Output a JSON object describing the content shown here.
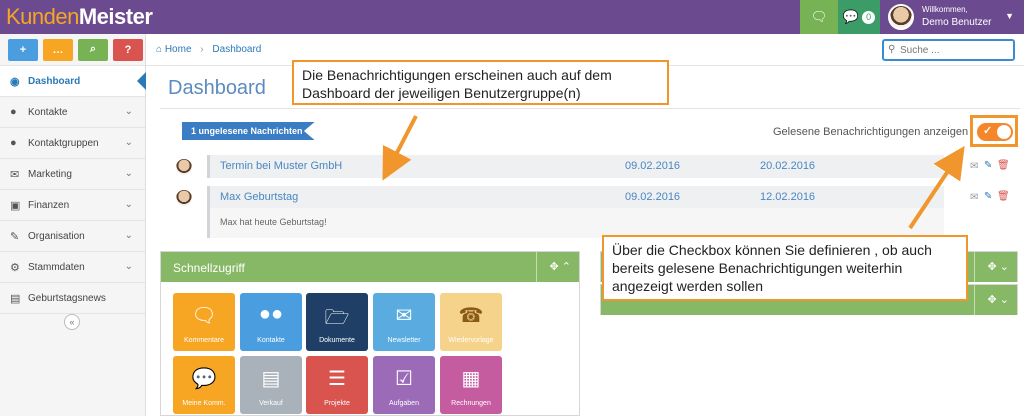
{
  "app": {
    "logo_part1": "Kunden",
    "logo_part2": "Meister"
  },
  "topbar": {
    "chat_icon": "comments-icon",
    "notif_icon": "comment-icon",
    "notif_count": "0",
    "user_welcome": "Willkommen,",
    "user_name": "Demo Benutzer"
  },
  "quick_actions": [
    {
      "label": "+",
      "icon": "plus-icon",
      "color": "#4a9ee0"
    },
    {
      "label": "…",
      "icon": "comments-icon",
      "color": "#f6a623"
    },
    {
      "label": "⌕",
      "icon": "search-icon",
      "color": "#77b255"
    },
    {
      "label": "?",
      "icon": "help-icon",
      "color": "#d9534f"
    }
  ],
  "sidebar": {
    "items": [
      {
        "label": "Dashboard",
        "icon": "dashboard-icon",
        "active": true
      },
      {
        "label": "Kontakte",
        "icon": "user-icon"
      },
      {
        "label": "Kontaktgruppen",
        "icon": "users-icon"
      },
      {
        "label": "Marketing",
        "icon": "envelope-icon"
      },
      {
        "label": "Finanzen",
        "icon": "money-icon"
      },
      {
        "label": "Organisation",
        "icon": "edit-icon"
      },
      {
        "label": "Stammdaten",
        "icon": "cogs-icon"
      },
      {
        "label": "Geburtstagsnews",
        "icon": "newspaper-icon"
      }
    ],
    "collapse_label": "«"
  },
  "breadcrumb": {
    "home": "Home",
    "current": "Dashboard"
  },
  "search": {
    "placeholder": "Suche ..."
  },
  "page": {
    "title": "Dashboard"
  },
  "notifications": {
    "unread_label": "1 ungelesene Nachrichten",
    "toggle_label": "Gelesene Benachrichtigungen anzeigen",
    "toggle_on": true,
    "items": [
      {
        "subject": "Termin bei Muster GmbH",
        "date_from": "09.02.2016",
        "date_to": "20.02.2016",
        "body": ""
      },
      {
        "subject": "Max Geburtstag",
        "date_from": "09.02.2016",
        "date_to": "12.02.2016",
        "body": "Max hat heute Geburtstag!"
      }
    ]
  },
  "quick_access": {
    "title": "Schnellzugriff",
    "tiles": [
      {
        "label": "Kommentare",
        "color": "#f6a623",
        "icon": "comments-icon"
      },
      {
        "label": "Kontakte",
        "color": "#4a9ee0",
        "icon": "users-icon"
      },
      {
        "label": "Dokumente",
        "color": "#1f3f66",
        "icon": "folder-open-icon"
      },
      {
        "label": "Newsletter",
        "color": "#5aace0",
        "icon": "newsletter-icon"
      },
      {
        "label": "Wiedervorlage",
        "color": "#f5d38a",
        "icon": "phone-clock-icon"
      },
      {
        "label": "Meine Komm.",
        "color": "#f6a623",
        "icon": "comment-icon"
      },
      {
        "label": "Verkauf",
        "color": "#a9b2ba",
        "icon": "chart-icon"
      },
      {
        "label": "Projekte",
        "color": "#d9534f",
        "icon": "clipboard-icon"
      },
      {
        "label": "Aufgaben",
        "color": "#9b6bb8",
        "icon": "check-square-icon"
      },
      {
        "label": "Rechnungen",
        "color": "#c65ca0",
        "icon": "calculator-icon"
      }
    ]
  },
  "callouts": {
    "dashboard_text": "Die Benachrichtigungen erscheinen auch auf dem Dashboard der jeweiligen Benutzergruppe(n)",
    "checkbox_text": "Über die Checkbox können Sie definieren , ob auch bereits  gelesene Benachrichtigungen weiterhin angezeigt werden sollen"
  }
}
